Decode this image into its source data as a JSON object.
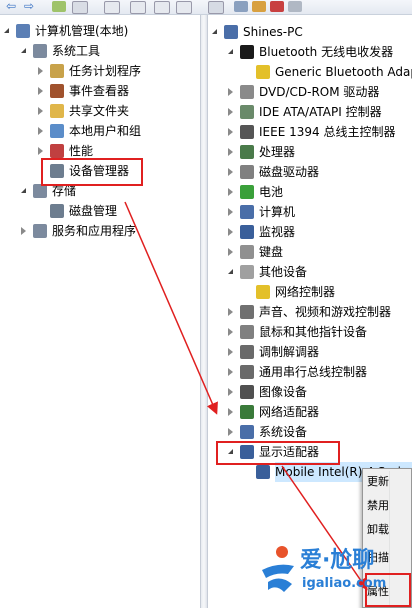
{
  "left_tree": [
    {
      "label": "计算机管理(本地)",
      "icon": "computer-management-icon",
      "level": 0,
      "expander": "open",
      "color": "#5b7fb5"
    },
    {
      "label": "系统工具",
      "icon": "system-tools-icon",
      "level": 1,
      "expander": "open",
      "color": "#7c8a9e"
    },
    {
      "label": "任务计划程序",
      "icon": "task-scheduler-icon",
      "level": 2,
      "expander": "closed",
      "color": "#c8a24a"
    },
    {
      "label": "事件查看器",
      "icon": "event-viewer-icon",
      "level": 2,
      "expander": "closed",
      "color": "#a0522d"
    },
    {
      "label": "共享文件夹",
      "icon": "shared-folder-icon",
      "level": 2,
      "expander": "closed",
      "color": "#e0b64a"
    },
    {
      "label": "本地用户和组",
      "icon": "local-users-icon",
      "level": 2,
      "expander": "closed",
      "color": "#5b8dc9"
    },
    {
      "label": "性能",
      "icon": "performance-icon",
      "level": 2,
      "expander": "closed",
      "color": "#c04040"
    },
    {
      "label": "设备管理器",
      "icon": "device-manager-icon",
      "level": 2,
      "expander": "none",
      "color": "#6d7d8f"
    },
    {
      "label": "存储",
      "icon": "storage-icon",
      "level": 1,
      "expander": "open",
      "color": "#7c8a9e"
    },
    {
      "label": "磁盘管理",
      "icon": "disk-management-icon",
      "level": 2,
      "expander": "none",
      "color": "#6d7d8f"
    },
    {
      "label": "服务和应用程序",
      "icon": "services-icon",
      "level": 1,
      "expander": "closed",
      "color": "#7c8a9e"
    }
  ],
  "right_tree": [
    {
      "label": "Shines-PC",
      "icon": "computer-icon",
      "level": 0,
      "expander": "open",
      "color": "#4a6ea8"
    },
    {
      "label": "Bluetooth 无线电收发器",
      "icon": "bluetooth-icon",
      "level": 1,
      "expander": "open",
      "color": "#1a1a1a"
    },
    {
      "label": "Generic Bluetooth Adapter",
      "icon": "warning-device-icon",
      "level": 2,
      "expander": "none",
      "color": "#e3c02a"
    },
    {
      "label": "DVD/CD-ROM 驱动器",
      "icon": "dvd-drive-icon",
      "level": 1,
      "expander": "closed",
      "color": "#8a8a8a"
    },
    {
      "label": "IDE ATA/ATAPI 控制器",
      "icon": "ide-controller-icon",
      "level": 1,
      "expander": "closed",
      "color": "#6a8a6a"
    },
    {
      "label": "IEEE 1394 总线主控制器",
      "icon": "ieee1394-icon",
      "level": 1,
      "expander": "closed",
      "color": "#555555"
    },
    {
      "label": "处理器",
      "icon": "processor-icon",
      "level": 1,
      "expander": "closed",
      "color": "#4a7a4a"
    },
    {
      "label": "磁盘驱动器",
      "icon": "disk-drive-icon",
      "level": 1,
      "expander": "closed",
      "color": "#808080"
    },
    {
      "label": "电池",
      "icon": "battery-icon",
      "level": 1,
      "expander": "closed",
      "color": "#3aa03a"
    },
    {
      "label": "计算机",
      "icon": "computer-node-icon",
      "level": 1,
      "expander": "closed",
      "color": "#4a6ea8"
    },
    {
      "label": "监视器",
      "icon": "monitor-icon",
      "level": 1,
      "expander": "closed",
      "color": "#3a5f9a"
    },
    {
      "label": "键盘",
      "icon": "keyboard-icon",
      "level": 1,
      "expander": "closed",
      "color": "#909090"
    },
    {
      "label": "其他设备",
      "icon": "other-devices-icon",
      "level": 1,
      "expander": "open",
      "color": "#a0a0a0"
    },
    {
      "label": "网络控制器",
      "icon": "warning-network-icon",
      "level": 2,
      "expander": "none",
      "color": "#e3c02a"
    },
    {
      "label": "声音、视频和游戏控制器",
      "icon": "sound-icon",
      "level": 1,
      "expander": "closed",
      "color": "#707070"
    },
    {
      "label": "鼠标和其他指针设备",
      "icon": "mouse-icon",
      "level": 1,
      "expander": "closed",
      "color": "#808080"
    },
    {
      "label": "调制解调器",
      "icon": "modem-icon",
      "level": 1,
      "expander": "closed",
      "color": "#6a6a6a"
    },
    {
      "label": "通用串行总线控制器",
      "icon": "usb-icon",
      "level": 1,
      "expander": "closed",
      "color": "#6a6a6a"
    },
    {
      "label": "图像设备",
      "icon": "imaging-icon",
      "level": 1,
      "expander": "closed",
      "color": "#505050"
    },
    {
      "label": "网络适配器",
      "icon": "network-adapter-icon",
      "level": 1,
      "expander": "closed",
      "color": "#3a7a3a"
    },
    {
      "label": "系统设备",
      "icon": "system-devices-icon",
      "level": 1,
      "expander": "closed",
      "color": "#4a6ea8"
    },
    {
      "label": "显示适配器",
      "icon": "display-adapter-icon",
      "level": 1,
      "expander": "open",
      "color": "#3a5f9a"
    },
    {
      "label": "Mobile Intel(R) 4 Series",
      "icon": "display-device-icon",
      "level": 2,
      "expander": "none",
      "color": "#3a5f9a"
    }
  ],
  "context_menu": {
    "items": [
      "更新",
      "禁用",
      "卸载",
      "扫描",
      "属性"
    ]
  },
  "watermark": {
    "brand": "爱·尬聊",
    "domain": "igaliao.com"
  },
  "colors": {
    "highlight": "#e02020",
    "selection": "#cde8ff",
    "arrow": "#e02020"
  }
}
